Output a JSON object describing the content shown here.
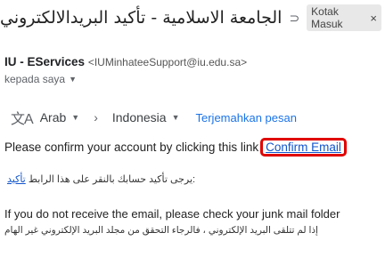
{
  "header": {
    "subject": "الجامعة الاسلامية - تأكيد البريدالالكتروني",
    "label_icon": "important-marker-icon",
    "label_chip": "Kotak Masuk",
    "label_chip_remove": "×"
  },
  "sender": {
    "name": "IU - EServices",
    "email": "<IUMinhateeSupport@iu.edu.sa>",
    "to": "kepada saya"
  },
  "translate": {
    "icon": "translate-icon",
    "from": "Arab",
    "arrow": "›",
    "to": "Indonesia",
    "action": "Terjemahkan pesan"
  },
  "body": {
    "confirm_text": "Please confirm your account by clicking this link",
    "confirm_link": "Confirm Email",
    "arabic_link": "تأكيد",
    "arabic_text": " :يرجى تأكيد حسابك بالنقر على هذا الرابط",
    "junk_text": "If you do not receive the email, please check your junk mail folder",
    "junk_arabic": "إذا لم تتلقى البريد الإلكتروني ، فالرجاء التحقق من مجلد البريد الإلكتروني غير الهام"
  },
  "colors": {
    "highlight_box": "#e00000",
    "link": "#1155cc",
    "translate_link": "#1a73e8"
  }
}
